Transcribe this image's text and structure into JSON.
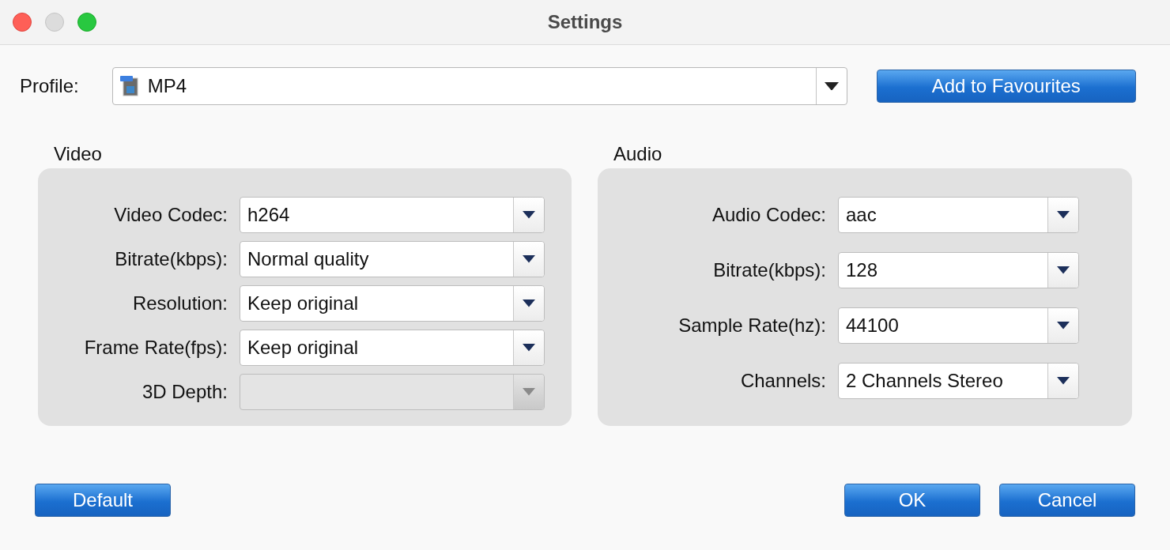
{
  "window": {
    "title": "Settings"
  },
  "profile": {
    "label": "Profile:",
    "value": "MP4",
    "button": "Add to Favourites"
  },
  "video": {
    "title": "Video",
    "fields": [
      {
        "label": "Video Codec:",
        "value": "h264",
        "disabled": false
      },
      {
        "label": "Bitrate(kbps):",
        "value": "Normal quality",
        "disabled": false
      },
      {
        "label": "Resolution:",
        "value": "Keep original",
        "disabled": false
      },
      {
        "label": "Frame Rate(fps):",
        "value": "Keep original",
        "disabled": false
      },
      {
        "label": "3D Depth:",
        "disabled": true
      }
    ]
  },
  "audio": {
    "title": "Audio",
    "fields": [
      {
        "label": "Audio Codec:",
        "value": "aac",
        "disabled": false
      },
      {
        "label": "Bitrate(kbps):",
        "value": "128",
        "disabled": false
      },
      {
        "label": "Sample Rate(hz):",
        "value": "44100",
        "disabled": false
      },
      {
        "label": "Channels:",
        "value": "2 Channels Stereo",
        "disabled": false
      }
    ]
  },
  "buttons": {
    "left": [
      "Default"
    ],
    "right": [
      "OK",
      "Cancel"
    ]
  }
}
